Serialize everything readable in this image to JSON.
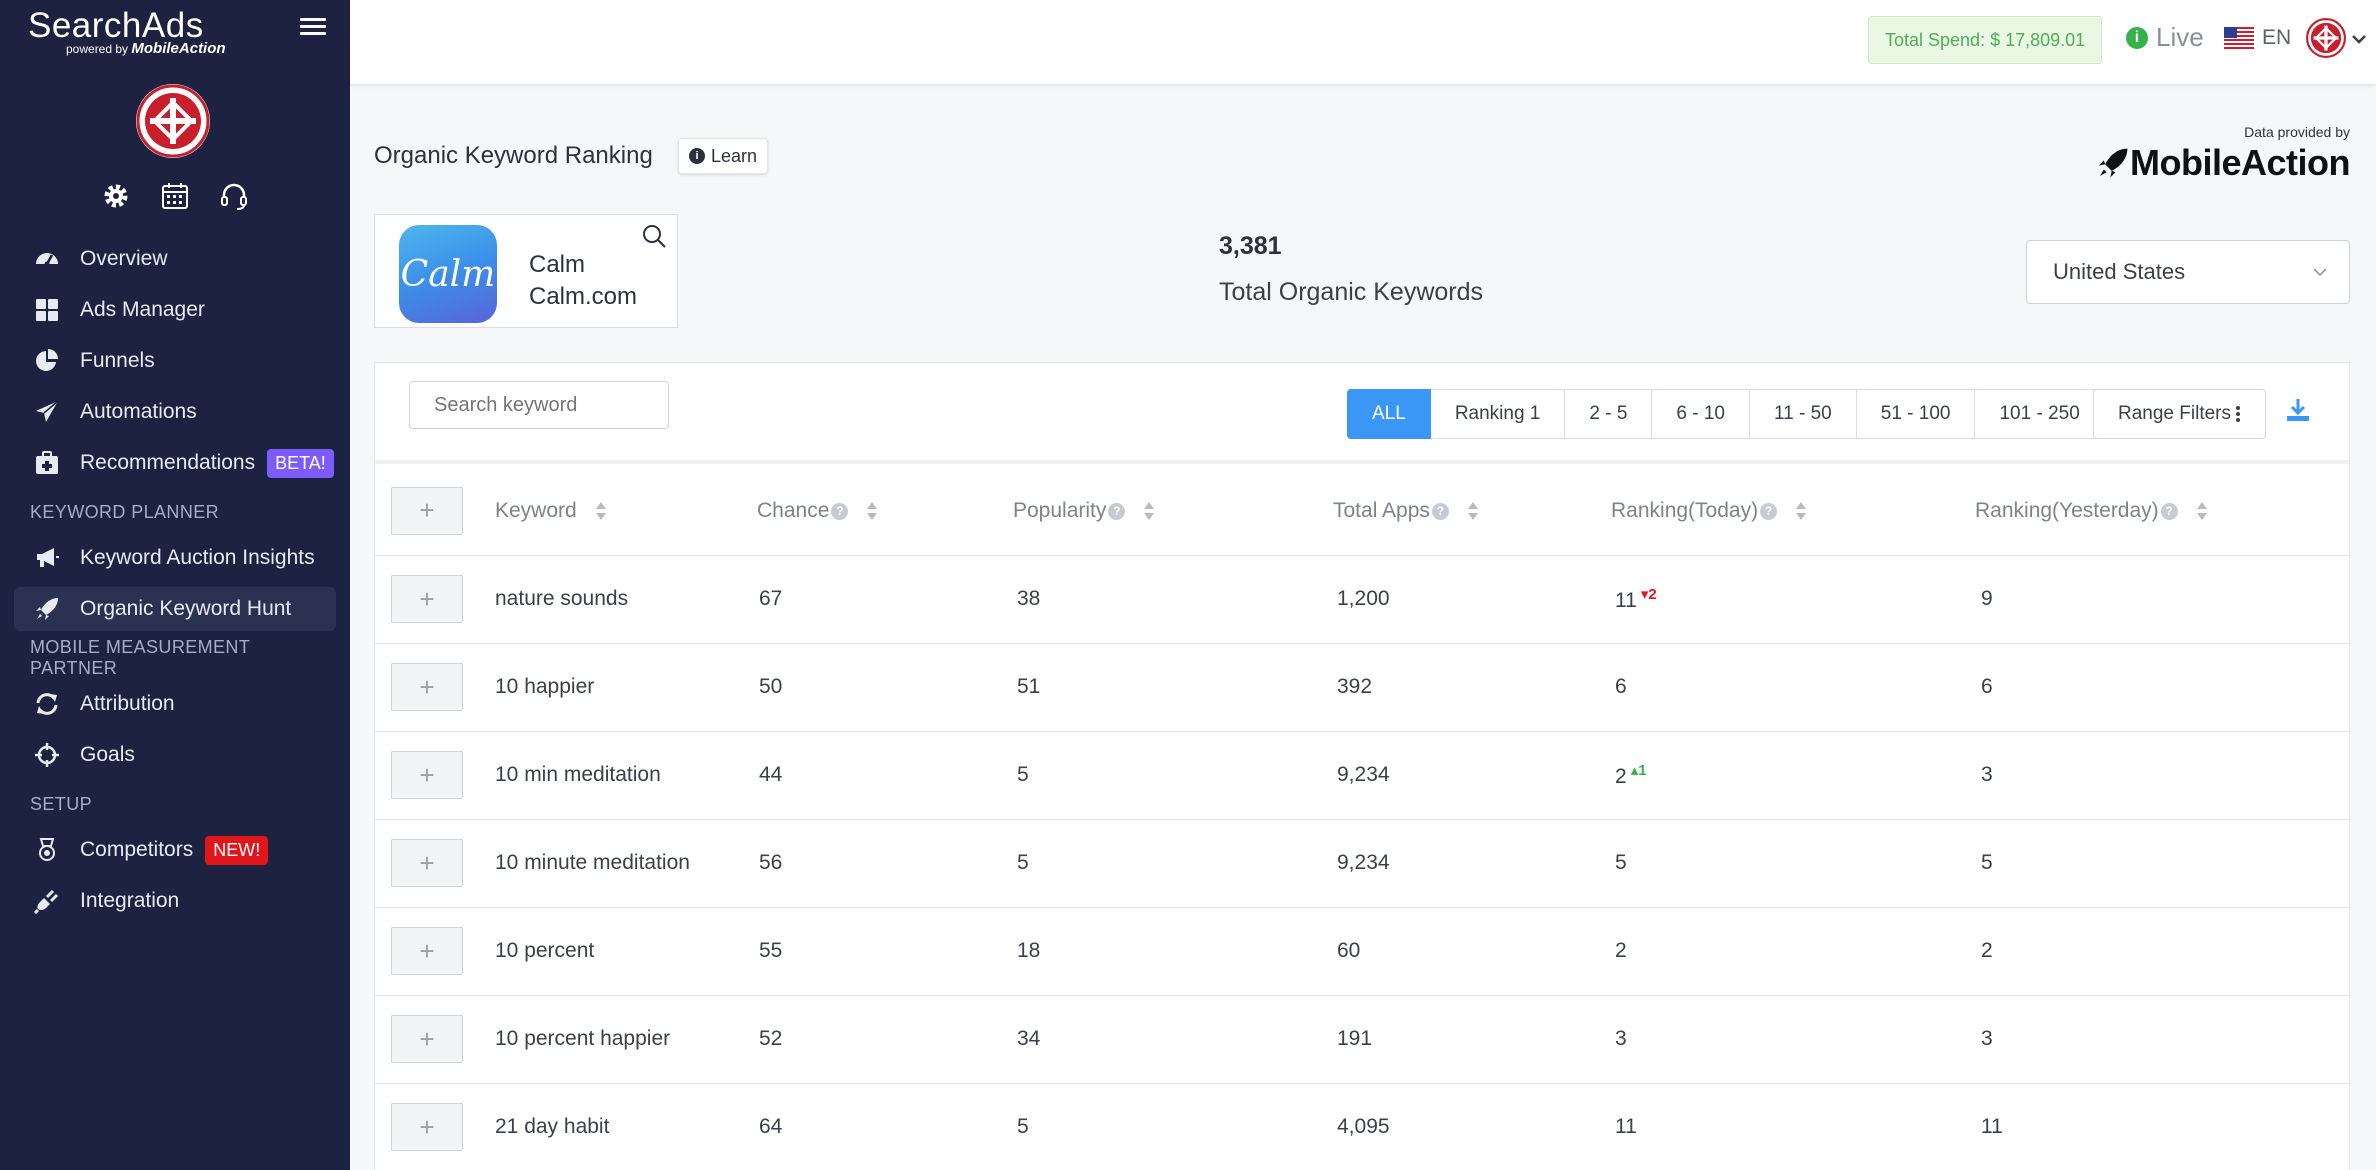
{
  "sidebar": {
    "logo_main": "SearchAds",
    "logo_powered": "powered by",
    "logo_brand": "MobileAction",
    "nav": [
      {
        "label": "Overview"
      },
      {
        "label": "Ads Manager"
      },
      {
        "label": "Funnels"
      },
      {
        "label": "Automations"
      },
      {
        "label": "Recommendations",
        "badge": "BETA!"
      }
    ],
    "section_keyword_planner": "KEYWORD PLANNER",
    "keyword_planner_items": [
      {
        "label": "Keyword Auction Insights"
      },
      {
        "label": "Organic Keyword Hunt"
      }
    ],
    "section_mmp": "MOBILE MEASUREMENT PARTNER",
    "mmp_items": [
      {
        "label": "Attribution"
      },
      {
        "label": "Goals"
      }
    ],
    "section_setup": "SETUP",
    "setup_items": [
      {
        "label": "Competitors",
        "badge": "NEW!"
      },
      {
        "label": "Integration"
      }
    ]
  },
  "topbar": {
    "total_spend": "Total Spend: $ 17,809.01",
    "live": "Live",
    "lang": "EN"
  },
  "header": {
    "title": "Organic Keyword Ranking",
    "learn": "Learn",
    "provided_by": "Data provided by",
    "provider": "MobileAction"
  },
  "app": {
    "icon_text": "Calm",
    "name": "Calm",
    "developer": "Calm.com"
  },
  "summary": {
    "count": "3,381",
    "label": "Total Organic Keywords"
  },
  "country": "United States",
  "toolbar": {
    "search_placeholder": "Search keyword",
    "filters": [
      "ALL",
      "Ranking 1",
      "2 - 5",
      "6 - 10",
      "11 - 50",
      "51 - 100",
      "101 - 250"
    ],
    "range_filters": "Range Filters"
  },
  "table": {
    "headers": {
      "keyword": "Keyword",
      "chance": "Chance",
      "popularity": "Popularity",
      "total_apps": "Total Apps",
      "ranking_today": "Ranking(Today)",
      "ranking_yesterday": "Ranking(Yesterday)"
    },
    "add": "+",
    "rows": [
      {
        "keyword": "nature sounds",
        "chance": "67",
        "popularity": "38",
        "total_apps": "1,200",
        "today": "11",
        "change": "2",
        "direction": "down",
        "yesterday": "9"
      },
      {
        "keyword": "10 happier",
        "chance": "50",
        "popularity": "51",
        "total_apps": "392",
        "today": "6",
        "change": "",
        "direction": "",
        "yesterday": "6"
      },
      {
        "keyword": "10 min meditation",
        "chance": "44",
        "popularity": "5",
        "total_apps": "9,234",
        "today": "2",
        "change": "1",
        "direction": "up",
        "yesterday": "3"
      },
      {
        "keyword": "10 minute meditation",
        "chance": "56",
        "popularity": "5",
        "total_apps": "9,234",
        "today": "5",
        "change": "",
        "direction": "",
        "yesterday": "5"
      },
      {
        "keyword": "10 percent",
        "chance": "55",
        "popularity": "18",
        "total_apps": "60",
        "today": "2",
        "change": "",
        "direction": "",
        "yesterday": "2"
      },
      {
        "keyword": "10 percent happier",
        "chance": "52",
        "popularity": "34",
        "total_apps": "191",
        "today": "3",
        "change": "",
        "direction": "",
        "yesterday": "3"
      },
      {
        "keyword": "21 day habit",
        "chance": "64",
        "popularity": "5",
        "total_apps": "4,095",
        "today": "11",
        "change": "",
        "direction": "",
        "yesterday": "11"
      }
    ]
  },
  "colors": {
    "sidebar_bg": "#1d2240",
    "accent_blue": "#3b97f5",
    "beta": "#7c5cff",
    "new": "#e0161b",
    "rank_up": "#35b24a",
    "rank_down": "#e0161b"
  },
  "icons": {
    "sidebar_top": [
      "gear-icon",
      "calendar-icon",
      "headset-icon"
    ],
    "nav": [
      "dashboard-gauge-icon",
      "grid-icon",
      "pie-chart-icon",
      "paper-plane-icon",
      "recommendations-icon",
      "megaphone-icon",
      "rocket-icon",
      "sync-icon",
      "crosshair-icon",
      "medal-icon",
      "plug-icon"
    ]
  }
}
